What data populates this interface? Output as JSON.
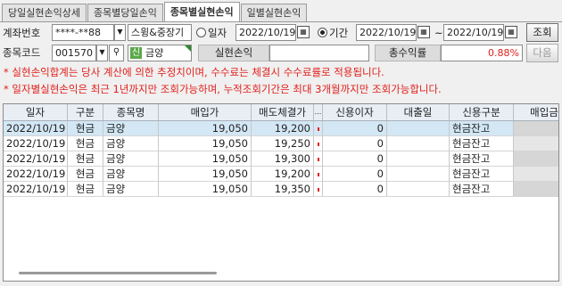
{
  "tabs": [
    {
      "label": "당일실현손익상세",
      "active": false
    },
    {
      "label": "종목별당일손익",
      "active": false
    },
    {
      "label": "종목별실현손익",
      "active": true
    },
    {
      "label": "일별실현손익",
      "active": false
    }
  ],
  "account": {
    "label": "계좌번호",
    "value": "****-**88",
    "type_value": "스윙&중장기"
  },
  "period": {
    "date_radio_label": "일자",
    "date_value": "2022/10/19",
    "range_radio_label": "기간",
    "range_selected": true,
    "from": "2022/10/19",
    "tilde": "~",
    "to": "2022/10/19",
    "search_button": "조회"
  },
  "stock": {
    "label": "종목코드",
    "code": "001570",
    "badge": "신",
    "name": "금양",
    "realized_label": "실현손익",
    "realized_value": "",
    "return_label": "총수익률",
    "return_value": "0.88%",
    "next_button": "다음"
  },
  "notices": [
    "* 실현손익합계는 당사 계산에 의한 추정치이며, 수수료는 체결시 수수료률로 적용됩니다.",
    "* 일자별실현손익은 최근 1년까지만 조회가능하며, 누적조회기간은 최대 3개월까지만 조회가능합니다."
  ],
  "table": {
    "columns": [
      "일자",
      "구분",
      "종목명",
      "매입가",
      "매도체결가",
      "...",
      "신용이자",
      "대출일",
      "신용구분",
      "매입금"
    ],
    "rows": [
      {
        "date": "2022/10/19",
        "type": "현금",
        "name": "금양",
        "buy": "19,050",
        "sell": "19,200",
        "interest": "0",
        "loan_date": "",
        "credit": "현금잔고"
      },
      {
        "date": "2022/10/19",
        "type": "현금",
        "name": "금양",
        "buy": "19,050",
        "sell": "19,250",
        "interest": "0",
        "loan_date": "",
        "credit": "현금잔고"
      },
      {
        "date": "2022/10/19",
        "type": "현금",
        "name": "금양",
        "buy": "19,050",
        "sell": "19,300",
        "interest": "0",
        "loan_date": "",
        "credit": "현금잔고"
      },
      {
        "date": "2022/10/19",
        "type": "현금",
        "name": "금양",
        "buy": "19,050",
        "sell": "19,200",
        "interest": "0",
        "loan_date": "",
        "credit": "현금잔고"
      },
      {
        "date": "2022/10/19",
        "type": "현금",
        "name": "금양",
        "buy": "19,050",
        "sell": "19,350",
        "interest": "0",
        "loan_date": "",
        "credit": "현금잔고"
      }
    ]
  },
  "colors": {
    "accent": "#e0201c",
    "selected_row": "#d3e7f5",
    "header_bg": "#e9eef5",
    "badge_bg": "#5aa84a"
  }
}
